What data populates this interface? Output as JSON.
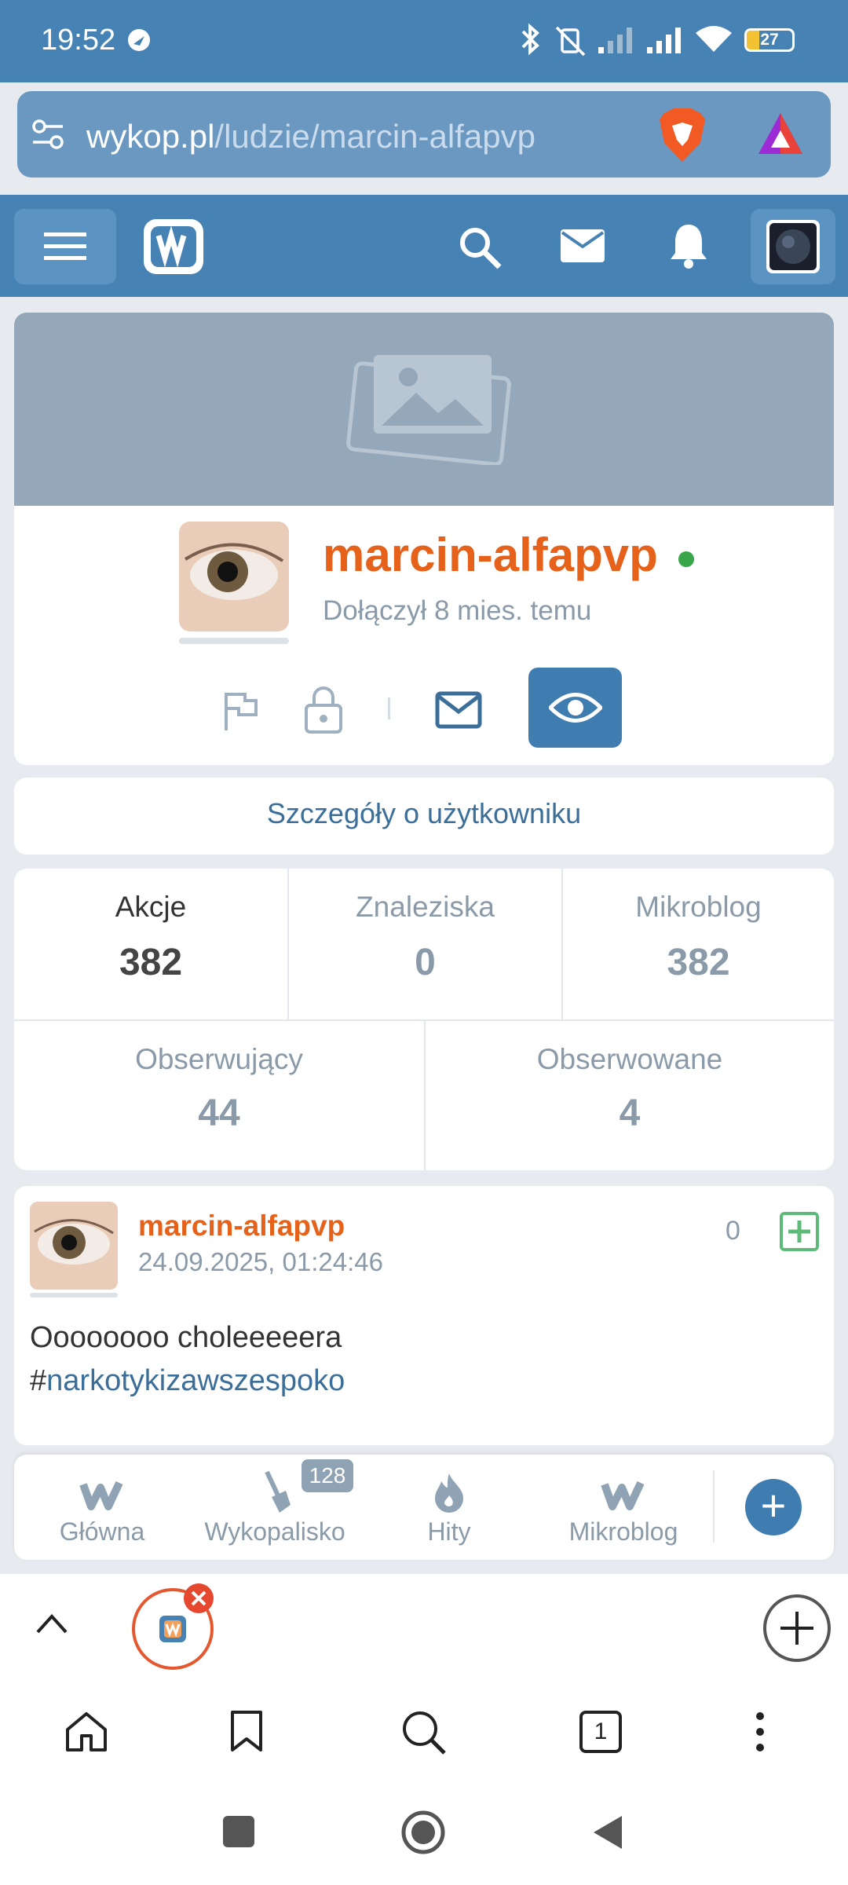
{
  "status_bar": {
    "time": "19:52",
    "battery": "27",
    "battery_level": 0.27
  },
  "browser": {
    "url_host": "wykop.pl",
    "url_path": "/ludzie/marcin-alfapvp",
    "tab_count": "1"
  },
  "profile": {
    "username": "marcin-alfapvp",
    "joined": "Dołączył 8 mies. temu",
    "online": true,
    "details_link": "Szczegóły o użytkowniku"
  },
  "stats": {
    "row1": [
      {
        "label": "Akcje",
        "value": "382",
        "active": true
      },
      {
        "label": "Znaleziska",
        "value": "0",
        "active": false
      },
      {
        "label": "Mikroblog",
        "value": "382",
        "active": false
      }
    ],
    "row2": [
      {
        "label": "Obserwujący",
        "value": "44"
      },
      {
        "label": "Obserwowane",
        "value": "4"
      }
    ]
  },
  "post": {
    "author": "marcin-alfapvp",
    "date": "24.09.2025, 01:24:46",
    "votes": "0",
    "text": "Oooooooo choleeeeera",
    "hash": "#",
    "tag": "narkotykizawszespoko"
  },
  "tabbar": {
    "items": [
      {
        "label": "Główna",
        "icon": "wykop-logo-icon"
      },
      {
        "label": "Wykopalisko",
        "icon": "shovel-icon",
        "badge": "128"
      },
      {
        "label": "Hity",
        "icon": "flame-icon"
      },
      {
        "label": "Mikroblog",
        "icon": "microblog-logo-icon"
      }
    ],
    "add_label": "+"
  },
  "colors": {
    "brand_blue": "#4682b4",
    "username_orange": "#e6611a",
    "online_green": "#3aa64a"
  }
}
